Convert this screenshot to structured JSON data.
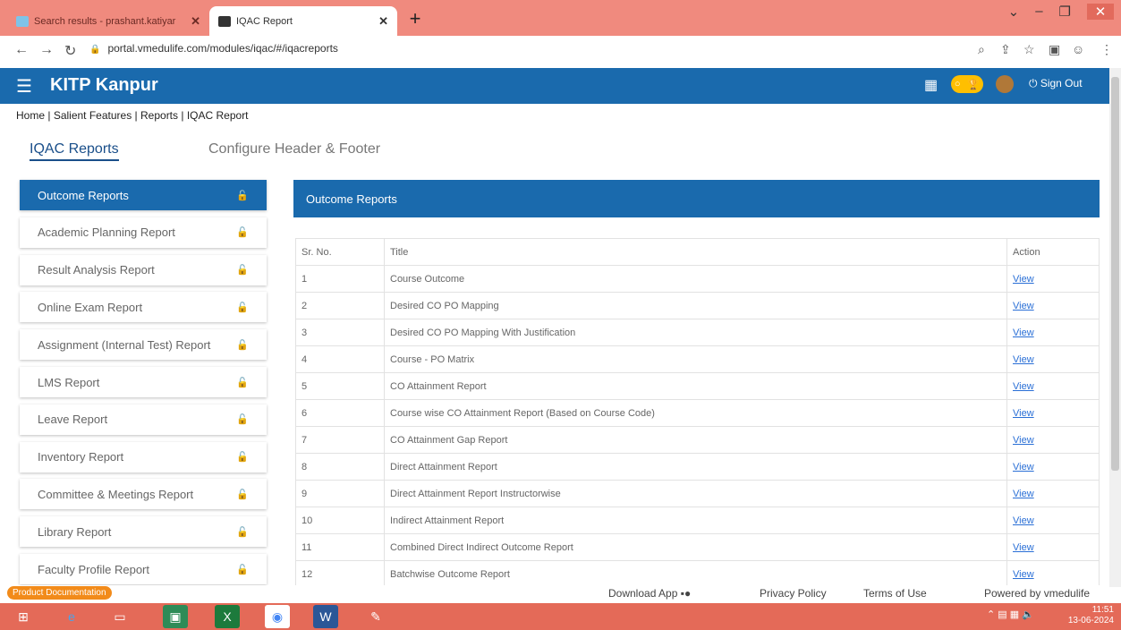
{
  "browser": {
    "tabs": [
      {
        "title": "Search results - prashant.katiyar",
        "active": false
      },
      {
        "title": "IQAC Report",
        "active": true
      }
    ],
    "url": "portal.vmedulife.com/modules/iqac/#/iqacreports"
  },
  "header": {
    "brand": "KITP Kanpur",
    "signout": "Sign Out"
  },
  "breadcrumb": [
    "Home",
    "Salient Features",
    "Reports",
    "IQAC Report"
  ],
  "page_tabs": [
    "IQAC Reports",
    "Configure Header & Footer"
  ],
  "sidebar": {
    "items": [
      {
        "label": "Outcome Reports",
        "active": true
      },
      {
        "label": "Academic Planning Report"
      },
      {
        "label": "Result Analysis Report"
      },
      {
        "label": "Online Exam Report"
      },
      {
        "label": "Assignment (Internal Test) Report"
      },
      {
        "label": "LMS Report"
      },
      {
        "label": "Leave Report"
      },
      {
        "label": "Inventory Report"
      },
      {
        "label": "Committee & Meetings Report"
      },
      {
        "label": "Library Report"
      },
      {
        "label": "Faculty Profile Report"
      }
    ]
  },
  "panel": {
    "title": "Outcome Reports",
    "columns": [
      "Sr. No.",
      "Title",
      "Action"
    ],
    "rows": [
      {
        "sr": "1",
        "title": "Course Outcome",
        "action": "View"
      },
      {
        "sr": "2",
        "title": "Desired CO PO Mapping",
        "action": "View"
      },
      {
        "sr": "3",
        "title": "Desired CO PO Mapping With Justification",
        "action": "View"
      },
      {
        "sr": "4",
        "title": "Course - PO Matrix",
        "action": "View"
      },
      {
        "sr": "5",
        "title": "CO Attainment Report",
        "action": "View"
      },
      {
        "sr": "6",
        "title": "Course wise CO Attainment Report (Based on Course Code)",
        "action": "View"
      },
      {
        "sr": "7",
        "title": "CO Attainment Gap Report",
        "action": "View"
      },
      {
        "sr": "8",
        "title": "Direct Attainment Report",
        "action": "View"
      },
      {
        "sr": "9",
        "title": "Direct Attainment Report Instructorwise",
        "action": "View"
      },
      {
        "sr": "10",
        "title": "Indirect Attainment Report",
        "action": "View"
      },
      {
        "sr": "11",
        "title": "Combined Direct Indirect Outcome Report",
        "action": "View"
      },
      {
        "sr": "12",
        "title": "Batchwise Outcome Report",
        "action": "View"
      }
    ]
  },
  "footer": {
    "product_doc": "Product Documentation",
    "download": "Download App",
    "privacy": "Privacy Policy",
    "terms": "Terms of Use",
    "powered": "Powered by vmedulife"
  },
  "taskbar": {
    "time": "11:51",
    "date": "13-06-2024"
  },
  "colors": {
    "brand_blue": "#1a6aad",
    "tab_strip": "#f08a7e",
    "taskbar": "#e46a58",
    "link": "#2a6fd6",
    "doc_badge": "#f28b1a"
  }
}
